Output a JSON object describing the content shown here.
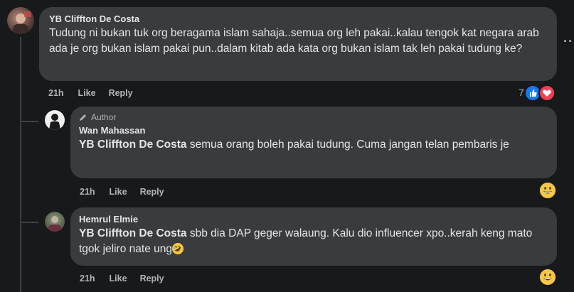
{
  "comments": [
    {
      "author": "YB Cliffton De Costa",
      "text": "Tudung ni bukan tuk org beragama islam sahaja..semua org leh pakai..kalau tengok kat negara arab ada je org bukan islam pakai pun..dalam kitab ada kata org bukan islam tak leh pakai tudung ke?",
      "time": "21h",
      "like_label": "Like",
      "reply_label": "Reply",
      "reaction_count": "7",
      "more_label": "···"
    }
  ],
  "replies": [
    {
      "author_tag": "Author",
      "author": "Wan Mahassan",
      "mention": "YB Cliffton De Costa",
      "text": "semua orang boleh pakai tudung. Cuma jangan telan pembaris je",
      "time": "21h",
      "like_label": "Like",
      "reply_label": "Reply"
    },
    {
      "author": "Hemrul Elmie",
      "mention": "YB Cliffton De Costa",
      "text": "sbb dia DAP geger walaung. Kalu dio influencer xpo..kerah keng mato tgok jeliro nate ung",
      "time": "21h",
      "like_label": "Like",
      "reply_label": "Reply"
    }
  ],
  "icons": {
    "like_reaction": "thumbs-up-icon",
    "love_reaction": "heart-icon",
    "author_badge": "pencil-icon",
    "grin_emoji": "grinning-emoji-icon",
    "rofl_emoji": "rolling-laughing-emoji-icon"
  },
  "colors": {
    "background": "#18191a",
    "bubble": "#3a3b3c",
    "like_blue": "#1877f2",
    "love_red": "#f33e58"
  }
}
